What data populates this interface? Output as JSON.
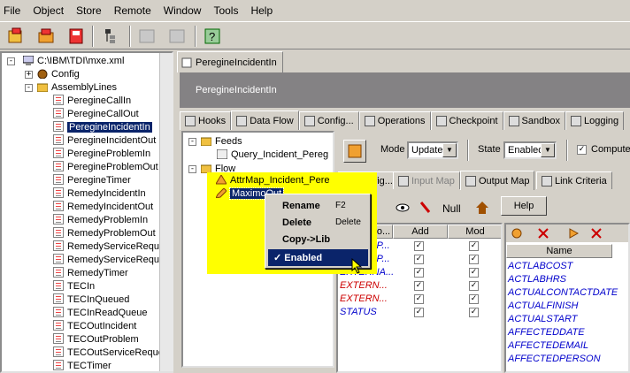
{
  "menu": [
    "File",
    "Object",
    "Store",
    "Remote",
    "Window",
    "Tools",
    "Help"
  ],
  "tree": {
    "root": "C:\\IBM\\TDI\\mxe.xml",
    "config": "Config",
    "assembly": "AssemblyLines",
    "items": [
      "PeregineCallIn",
      "PeregineCallOut",
      "PeregineIncidentIn",
      "PeregineIncidentOut",
      "PeregineProblemIn",
      "PeregineProblemOut",
      "PeregineTimer",
      "RemedyIncidentIn",
      "RemedyIncidentOut",
      "RemedyProblemIn",
      "RemedyProblemOut",
      "RemedyServiceReque",
      "RemedyServiceReque",
      "RemedyTimer",
      "TECIn",
      "TECInQueued",
      "TECInReadQueue",
      "TECOutIncident",
      "TECOutProblem",
      "TECOutServiceReque",
      "TECTimer"
    ],
    "selected_index": 2
  },
  "main_tab": "PeregineIncidentIn",
  "panel_title": "PeregineIncidentIn",
  "tabs": [
    "Hooks",
    "Data Flow",
    "Config...",
    "Operations",
    "Checkpoint",
    "Sandbox",
    "Logging"
  ],
  "active_tab": "Data Flow",
  "flow_tree": {
    "feeds": "Feeds",
    "feed_item": "Query_Incident_Pereg",
    "flow": "Flow",
    "flow_item1": "AttrMap_Incident_Pere",
    "flow_item2": "MaximoOut"
  },
  "mode": {
    "label": "Mode",
    "value": "Update"
  },
  "state": {
    "label": "State",
    "value": "Enabled"
  },
  "compute_label": "Compute",
  "subtabs": [
    "Config...",
    "Input Map",
    "Output Map",
    "Link Criteria"
  ],
  "active_subtab": "Output Map",
  "null_label": "Null",
  "help_label": "Help",
  "grid": {
    "headers": [
      "Connecto...",
      "Add",
      "Mod"
    ],
    "rows": [
      {
        "name": "DESCRIP...",
        "color": "#0000cc"
      },
      {
        "name": "DESCRIP...",
        "color": "#0000cc"
      },
      {
        "name": "EXTERNA...",
        "color": "#0000cc"
      },
      {
        "name": "EXTERN...",
        "color": "#cc0000"
      },
      {
        "name": "EXTERN...",
        "color": "#cc0000"
      },
      {
        "name": "STATUS",
        "color": "#0000cc"
      }
    ]
  },
  "name_grid": {
    "header": "Name",
    "rows": [
      "ACTLABCOST",
      "ACTLABHRS",
      "ACTUALCONTACTDATE",
      "ACTUALFINISH",
      "ACTUALSTART",
      "AFFECTEDDATE",
      "AFFECTEDEMAIL",
      "AFFECTEDPERSON"
    ]
  },
  "context_menu": [
    {
      "label": "Rename",
      "shortcut": "F2"
    },
    {
      "label": "Delete",
      "shortcut": "Delete"
    },
    {
      "label": "Copy->Lib",
      "shortcut": ""
    },
    {
      "label": "✓ Enabled",
      "shortcut": ""
    }
  ],
  "colors": {
    "highlight": "#ffff00",
    "selection": "#0a246a",
    "title": "#848284"
  }
}
